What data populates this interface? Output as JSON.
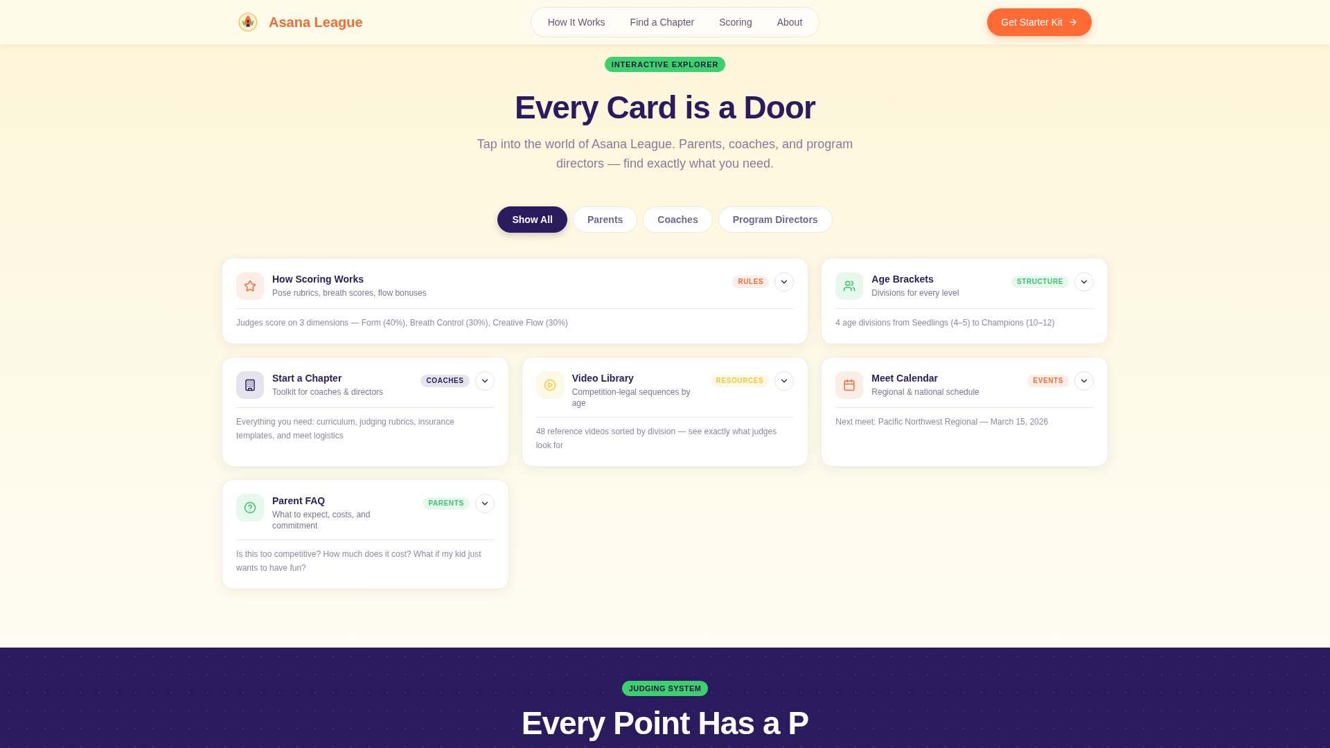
{
  "header": {
    "brand": "Asana League",
    "nav": [
      {
        "label": "How It Works"
      },
      {
        "label": "Find a Chapter"
      },
      {
        "label": "Scoring"
      },
      {
        "label": "About"
      }
    ],
    "cta": "Get Starter Kit"
  },
  "hero": {
    "badge": "INTERACTIVE EXPLORER",
    "title": "Every Card is a Door",
    "subtitle": "Tap into the world of Asana League. Parents, coaches, and program directors — find exactly what you need."
  },
  "filters": [
    {
      "label": "Show All",
      "selected": true
    },
    {
      "label": "Parents",
      "selected": false
    },
    {
      "label": "Coaches",
      "selected": false
    },
    {
      "label": "Program Directors",
      "selected": false
    }
  ],
  "cards": [
    {
      "kind": "wide",
      "title": "How Scoring Works",
      "subtitle": "Pose rubrics, breath scores, flow bonuses",
      "tag": "RULES",
      "color": "#f26c36",
      "body": "Judges score on 3 dimensions — Form (40%), Breath Control (30%), Creative Flow (30%)"
    },
    {
      "kind": "standard",
      "title": "Age Brackets",
      "subtitle": "Divisions for every level",
      "tag": "STRUCTURE",
      "color": "#3cc46c",
      "body": "4 age divisions from Seedlings (4–5) to Champions (10–12)"
    },
    {
      "kind": "standard",
      "title": "Start a Chapter",
      "subtitle": "Toolkit for coaches & directors",
      "tag": "COACHES",
      "color": "#2a1a5e",
      "body": "Everything you need: curriculum, judging rubrics, insurance templates, and meet logistics"
    },
    {
      "kind": "standard",
      "title": "Video Library",
      "subtitle": "Competition-legal sequences by age",
      "tag": "RESOURCES",
      "color": "#f5c83a",
      "body": "48 reference videos sorted by division — see exactly what judges look for"
    },
    {
      "kind": "standard",
      "title": "Meet Calendar",
      "subtitle": "Regional & national schedule",
      "tag": "EVENTS",
      "color": "#f26c36",
      "body": "Next meet: Pacific Northwest Regional — March 15, 2026"
    },
    {
      "kind": "standard",
      "title": "Parent FAQ",
      "subtitle": "What to expect, costs, and commitment",
      "tag": "PARENTS",
      "color": "#3cc46c",
      "body": "Is this too competitive? How much does it cost? What if my kid just wants to have fun?"
    }
  ],
  "judging": {
    "badge": "JUDGING SYSTEM",
    "title": "Every Point Has a P"
  }
}
